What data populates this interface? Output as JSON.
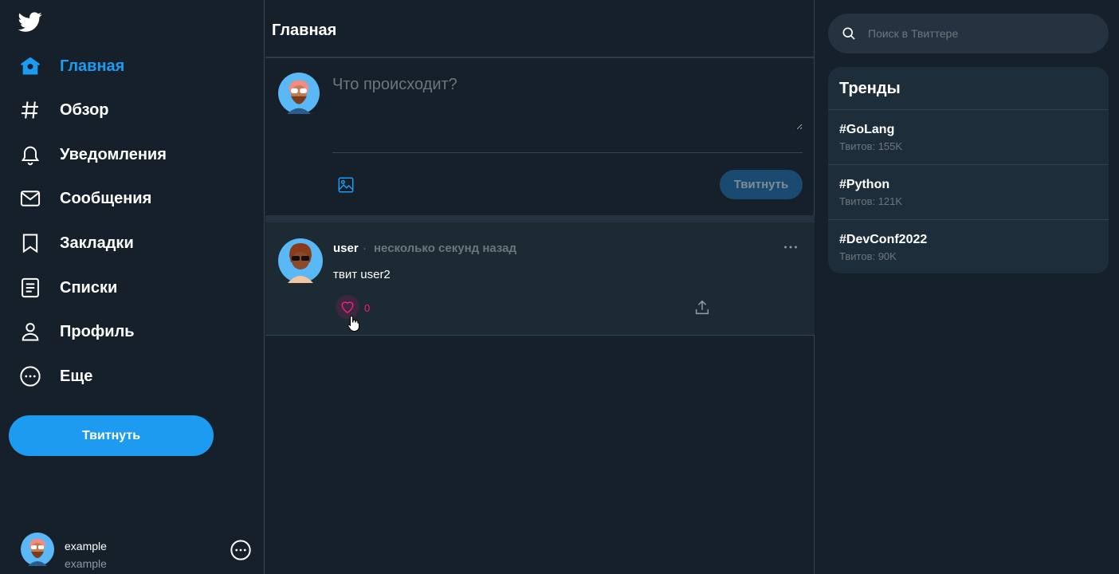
{
  "sidebar": {
    "nav": [
      {
        "label": "Главная",
        "icon": "home-icon",
        "active": true
      },
      {
        "label": "Обзор",
        "icon": "hashtag-icon"
      },
      {
        "label": "Уведомления",
        "icon": "bell-icon"
      },
      {
        "label": "Сообщения",
        "icon": "envelope-icon"
      },
      {
        "label": "Закладки",
        "icon": "bookmark-icon"
      },
      {
        "label": "Списки",
        "icon": "list-icon"
      },
      {
        "label": "Профиль",
        "icon": "profile-icon"
      },
      {
        "label": "Еще",
        "icon": "more-circle-icon"
      }
    ],
    "tweet_button": "Твитнуть",
    "account": {
      "name": "example",
      "handle": "example"
    }
  },
  "main": {
    "title": "Главная",
    "compose": {
      "placeholder": "Что происходит?",
      "submit_label": "Твитнуть"
    },
    "tweets": [
      {
        "author": "user",
        "separator": "·",
        "time": "несколько секунд назад",
        "text": "твит user2",
        "likes": "0"
      }
    ]
  },
  "right": {
    "search_placeholder": "Поиск в Твиттере",
    "trends_title": "Тренды",
    "trends": [
      {
        "tag": "#GoLang",
        "count": "Твитов: 155K"
      },
      {
        "tag": "#Python",
        "count": "Твитов: 121K"
      },
      {
        "tag": "#DevConf2022",
        "count": "Твитов: 90K"
      }
    ]
  },
  "colors": {
    "background": "#15202b",
    "accent": "#1d9bf0",
    "like": "#f91880",
    "muted": "#6e767d",
    "border": "#38444d"
  }
}
